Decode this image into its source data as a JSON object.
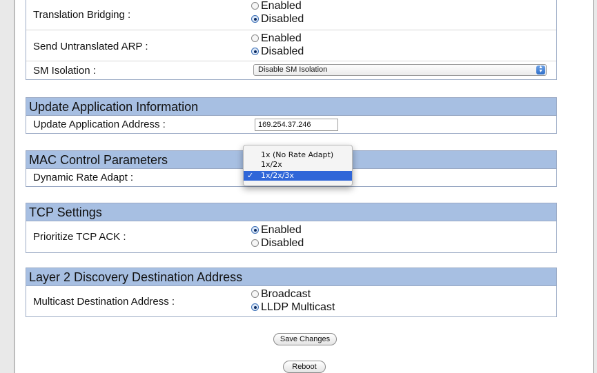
{
  "translation_bridging": {
    "label": "Translation Bridging :",
    "options": [
      "Enabled",
      "Disabled"
    ],
    "selected": "Disabled"
  },
  "send_untranslated_arp": {
    "label": "Send Untranslated ARP :",
    "options": [
      "Enabled",
      "Disabled"
    ],
    "selected": "Disabled"
  },
  "sm_isolation": {
    "label": "SM Isolation :",
    "value": "Disable SM Isolation"
  },
  "update_app": {
    "title": "Update Application Information",
    "address_label": "Update Application Address :",
    "address_value": "169.254.37.246"
  },
  "mac_control": {
    "title": "MAC Control Parameters",
    "rate_label": "Dynamic Rate Adapt :",
    "rate_options": [
      "1x (No Rate Adapt)",
      "1x/2x",
      "1x/2x/3x"
    ],
    "rate_selected": "1x/2x/3x",
    "check_glyph": "✓"
  },
  "tcp": {
    "title": "TCP Settings",
    "ack_label": "Prioritize TCP ACK :",
    "options": [
      "Enabled",
      "Disabled"
    ],
    "selected": "Enabled"
  },
  "layer2": {
    "title": "Layer 2 Discovery Destination Address",
    "multicast_label": "Multicast Destination Address :",
    "options": [
      "Broadcast",
      "LLDP Multicast"
    ],
    "selected": "LLDP Multicast"
  },
  "buttons": {
    "save": "Save Changes",
    "reboot": "Reboot"
  }
}
